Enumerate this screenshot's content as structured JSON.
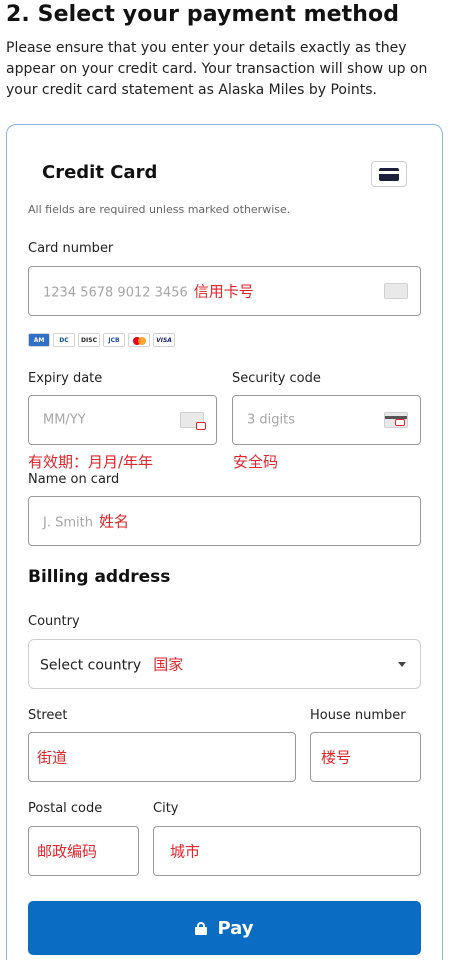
{
  "header": {
    "title": "2. Select your payment method",
    "intro": "Please ensure that you enter your details exactly as they appear on your credit card. Your transaction will show up on your credit card statement as Alaska Miles by Points."
  },
  "card_section": {
    "title": "Credit Card",
    "icon": "credit-card-icon",
    "required_note": "All fields are required unless marked otherwise.",
    "card_number": {
      "label": "Card number",
      "placeholder": "1234 5678 9012 3456",
      "annotation": "信用卡号"
    },
    "brands": [
      "amex",
      "diners",
      "discover",
      "jcb",
      "mastercard",
      "visa"
    ],
    "brand_text": {
      "amex": "AM",
      "diners": "DC",
      "discover": "DISC",
      "jcb": "JCB",
      "visa": "VISA"
    },
    "expiry": {
      "label": "Expiry date",
      "placeholder": "MM/YY",
      "annotation": "有效期：月月/年年"
    },
    "security": {
      "label": "Security code",
      "placeholder": "3 digits",
      "annotation": "安全码"
    },
    "name": {
      "label": "Name on card",
      "placeholder": "J. Smith",
      "annotation": "姓名"
    }
  },
  "billing": {
    "title": "Billing address",
    "country": {
      "label": "Country",
      "value": "Select country",
      "annotation": "国家"
    },
    "street": {
      "label": "Street",
      "annotation": "街道"
    },
    "house": {
      "label": "House number",
      "annotation": "楼号"
    },
    "postal": {
      "label": "Postal code",
      "annotation": "邮政编码"
    },
    "city": {
      "label": "City",
      "annotation": "城市"
    }
  },
  "pay_button": {
    "label": "Pay",
    "icon": "lock-icon",
    "color": "#0a6cc2"
  },
  "colors": {
    "annotation_red": "#e0262b",
    "card_border": "#8ab4f0"
  }
}
